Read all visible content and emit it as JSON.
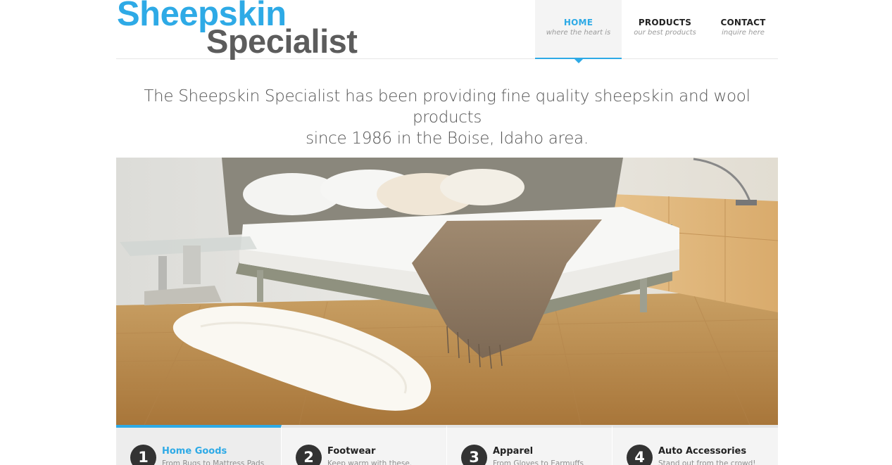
{
  "logo": {
    "line1": "Sheepskin",
    "line2": "Specialist",
    "colors": {
      "primary": "#2eaae6",
      "secondary": "#5c5c5c"
    }
  },
  "nav": {
    "items": [
      {
        "title": "HOME",
        "subtitle": "where the heart is",
        "active": true
      },
      {
        "title": "PRODUCTS",
        "subtitle": "our best products",
        "active": false
      },
      {
        "title": "CONTACT",
        "subtitle": "inquire here",
        "active": false
      }
    ]
  },
  "intro": {
    "line1": "The Sheepskin Specialist has been providing fine quality sheepskin and wool products",
    "line2": "since 1986 in the Boise, Idaho area."
  },
  "hero": {
    "image": "bedroom-with-sheepskin-rug"
  },
  "tabs": [
    {
      "number": "1",
      "title": "Home Goods",
      "subtitle": "From Rugs to Mattress Pads",
      "active": true
    },
    {
      "number": "2",
      "title": "Footwear",
      "subtitle": "Keep warm with these.",
      "active": false
    },
    {
      "number": "3",
      "title": "Apparel",
      "subtitle": "From Gloves to Earmuffs",
      "active": false
    },
    {
      "number": "4",
      "title": "Auto Accessories",
      "subtitle": "Stand out from the crowd!",
      "active": false
    }
  ],
  "accent_color": "#2eaae6"
}
